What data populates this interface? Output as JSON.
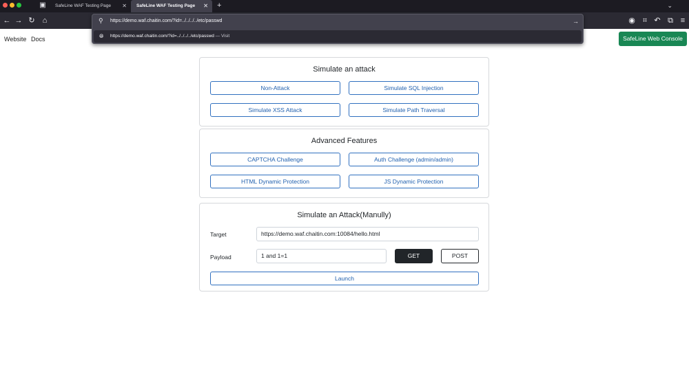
{
  "browser": {
    "tabs": [
      {
        "label": "SafeLine WAF Testing Page",
        "active": false
      },
      {
        "label": "SafeLine WAF Testing Page",
        "active": true
      }
    ],
    "url_value": "https://demo.waf.chaitin.com/?id=../../../../etc/passwd",
    "suggestion": {
      "text": "https://demo.waf.chaitin.com/?id=../../../../etc/passwd",
      "action": "— Visit"
    },
    "new_tab_glyph": "+",
    "tab_close_glyph": "✕",
    "colors": {
      "tabbar": "#1c1b22",
      "toolbar": "#2b2a33",
      "urlbox": "#42414d"
    }
  },
  "nav": {
    "website": "Website",
    "docs": "Docs",
    "console_button": "SafeLine Web Console"
  },
  "cards": {
    "attack": {
      "title": "Simulate an attack",
      "buttons": [
        "Non-Attack",
        "Simulate SQL Injection",
        "Simulate XSS Attack",
        "Simulate Path Traversal"
      ]
    },
    "advanced": {
      "title": "Advanced Features",
      "buttons": [
        "CAPTCHA Challenge",
        "Auth Challenge (admin/admin)",
        "HTML Dynamic Protection",
        "JS Dynamic Protection"
      ]
    },
    "manual": {
      "title": "Simulate an Attack(Manully)",
      "target_label": "Target",
      "target_value": "https://demo.waf.chaitin.com:10084/hello.html",
      "payload_label": "Payload",
      "payload_value": "1 and 1=1",
      "get_button": "GET",
      "post_button": "POST",
      "launch_button": "Launch"
    }
  },
  "colors": {
    "accent": "#198754",
    "outline": "#2f6fbf",
    "dark": "#212529"
  }
}
